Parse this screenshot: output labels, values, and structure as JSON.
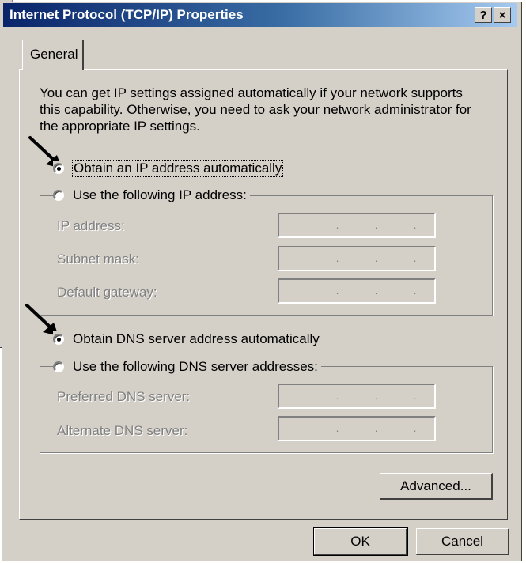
{
  "window": {
    "title": "Internet Protocol (TCP/IP) Properties",
    "help_glyph": "?",
    "close_glyph": "×"
  },
  "tabs": [
    {
      "label": "General",
      "selected": true
    }
  ],
  "intro_text": "You can get IP settings assigned automatically if your network supports this capability. Otherwise, you need to ask your network administrator for the appropriate IP settings.",
  "ip": {
    "auto_label": "Obtain an IP address automatically",
    "manual_label": "Use the following IP address:",
    "selected": "auto",
    "fields": [
      {
        "label": "IP address:",
        "value": ". . ."
      },
      {
        "label": "Subnet mask:",
        "value": ". . ."
      },
      {
        "label": "Default gateway:",
        "value": ". . ."
      }
    ]
  },
  "dns": {
    "auto_label": "Obtain DNS server address automatically",
    "manual_label": "Use the following DNS server addresses:",
    "selected": "auto",
    "fields": [
      {
        "label": "Preferred DNS server:",
        "value": ". . ."
      },
      {
        "label": "Alternate DNS server:",
        "value": ". . ."
      }
    ]
  },
  "buttons": {
    "advanced": "Advanced...",
    "ok": "OK",
    "cancel": "Cancel"
  },
  "colors": {
    "face": "#d4d0c8",
    "title_start": "#0a246a",
    "title_end": "#a6caf0",
    "disabled_text": "#808080"
  }
}
